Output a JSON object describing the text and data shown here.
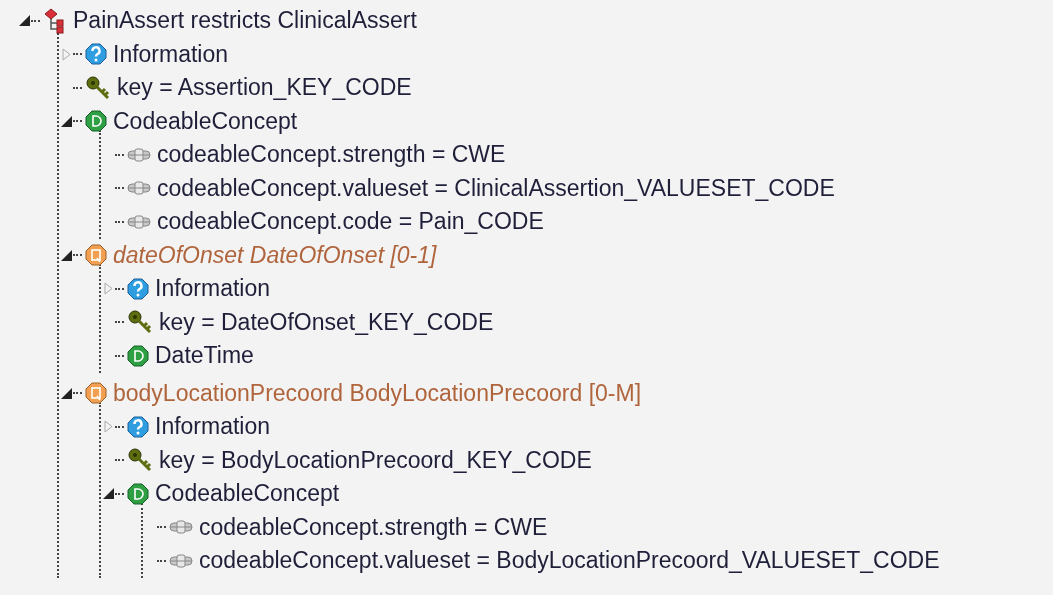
{
  "tree": {
    "kind": "package",
    "label": "PainAssert restricts ClinicalAssert",
    "expanded": true,
    "children": [
      {
        "kind": "info",
        "label": "Information",
        "expanded": false
      },
      {
        "kind": "key",
        "label": "key = Assertion_KEY_CODE"
      },
      {
        "kind": "datatype",
        "label": "CodeableConcept",
        "expanded": true,
        "children": [
          {
            "kind": "attribute",
            "label": "codeableConcept.strength = CWE"
          },
          {
            "kind": "attribute",
            "label": "codeableConcept.valueset = ClinicalAssertion_VALUESET_CODE"
          },
          {
            "kind": "attribute",
            "label": "codeableConcept.code = Pain_CODE"
          }
        ]
      },
      {
        "kind": "property",
        "label": "dateOfOnset DateOfOnset [0-1]",
        "italic": true,
        "expanded": true,
        "children": [
          {
            "kind": "info",
            "label": "Information",
            "expanded": false
          },
          {
            "kind": "key",
            "label": "key = DateOfOnset_KEY_CODE"
          },
          {
            "kind": "datatype",
            "label": "DateTime"
          }
        ]
      },
      {
        "kind": "property",
        "label": "bodyLocationPrecoord BodyLocationPrecoord [0-M]",
        "italic": false,
        "expanded": true,
        "children": [
          {
            "kind": "info",
            "label": "Information",
            "expanded": false
          },
          {
            "kind": "key",
            "label": "key = BodyLocationPrecoord_KEY_CODE"
          },
          {
            "kind": "datatype",
            "label": "CodeableConcept",
            "expanded": true,
            "children": [
              {
                "kind": "attribute",
                "label": "codeableConcept.strength = CWE"
              },
              {
                "kind": "attribute",
                "label": "codeableConcept.valueset = BodyLocationPrecoord_VALUESET_CODE"
              }
            ]
          }
        ]
      }
    ]
  }
}
